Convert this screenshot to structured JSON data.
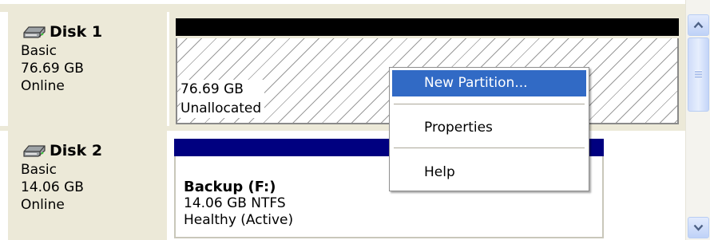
{
  "disks": [
    {
      "name": "Disk 1",
      "type": "Basic",
      "size": "76.69 GB",
      "status": "Online",
      "icon": "disk-drive-icon",
      "volume": {
        "size": "76.69 GB",
        "status": "Unallocated"
      }
    },
    {
      "name": "Disk 2",
      "type": "Basic",
      "size": "14.06 GB",
      "status": "Online",
      "icon": "disk-drive-icon",
      "volume": {
        "name": "Backup  (F:)",
        "detail": "14.06 GB NTFS",
        "status": "Healthy (Active)"
      }
    }
  ],
  "context_menu": {
    "items": [
      {
        "label": "New Partition...",
        "highlighted": true
      },
      {
        "label": "Properties",
        "highlighted": false
      },
      {
        "label": "Help",
        "highlighted": false
      }
    ]
  },
  "scrollbar": {
    "up_icon": "scroll-up-arrow-icon",
    "down_icon": "scroll-down-arrow-icon"
  },
  "colors": {
    "panel_bg": "#ece9d8",
    "unallocated_header": "#000000",
    "primary_partition_header": "#000080",
    "menu_highlight": "#316ac5"
  }
}
